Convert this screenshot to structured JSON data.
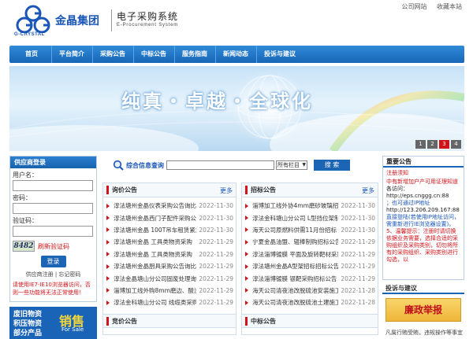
{
  "header": {
    "brand_cn": "金晶集团",
    "brand_logo_text": "G-CRYSTAL",
    "system_cn": "电子采购系统",
    "system_en": "E-Procurement System",
    "top_links": [
      "公司网站",
      "收藏本站"
    ]
  },
  "nav": {
    "items": [
      "首页",
      "平台简介",
      "采购公告",
      "中标公告",
      "服务指南",
      "新闻动态",
      "投诉与建议"
    ]
  },
  "banner": {
    "slogan": "纯真・卓越・全球化",
    "pages": [
      "1",
      "2",
      "3",
      "4"
    ],
    "active_page": "3"
  },
  "login": {
    "title": "供应商登录",
    "username_label": "用户名：",
    "password_label": "密码：",
    "captcha_label": "验证码：",
    "captcha_value": "8482",
    "refresh_link": "刷新验证码",
    "login_button": "登录",
    "register_link": "供应商注册",
    "forgot_link": "忘记密码",
    "warning": "请使用IE7-IE10浏览器访问，否则一些功能将无法正常使用！"
  },
  "promo": {
    "lines": [
      "废旧物资",
      "积压物资",
      "部分产品"
    ],
    "sale_cn": "销售",
    "sale_en": "For Sale"
  },
  "search": {
    "label": "综合信息查询",
    "select_value": "所有栏目",
    "button": "搜 索"
  },
  "inquiry": {
    "title": "询价公告",
    "more": "更多",
    "rows": [
      {
        "title": "淳法塘州金晶仪表采购公告询比价",
        "date": "2022-11-30"
      },
      {
        "title": "淳法塘州金晶西门子配件采购公告",
        "date": "2022-11-30"
      },
      {
        "title": "淳法塘州金晶 100T吊车租赁紧急",
        "date": "2022-11-30"
      },
      {
        "title": "淳法塘州金晶 工具类物资采购",
        "date": "2022-11-29"
      },
      {
        "title": "淳法塘州金晶 工具类物资采购",
        "date": "2022-11-29"
      },
      {
        "title": "淳法塘州金晶厨具采购公告询比价",
        "date": "2022-11-29"
      },
      {
        "title": "淳法金晶塘山分公司固废处理询比",
        "date": "2022-11-29"
      },
      {
        "title": "淄博加工线外购8mm磨边、酸洗玻",
        "date": "2022-11-29"
      },
      {
        "title": "淳法金科塘山分公司 线缆类采购询",
        "date": "2022-11-29"
      }
    ]
  },
  "tender": {
    "title": "招标公告",
    "more": "更多",
    "rows": [
      {
        "title": "淄博加工线外协4mm磨砂玻璃招标",
        "date": "2022-11-30"
      },
      {
        "title": "淳法金科塘山分公司 L型挡位架制",
        "date": "2022-11-30"
      },
      {
        "title": "海天公司原燃料供需11月份招标",
        "date": "2022-11-30"
      },
      {
        "title": "宁夏金晶油盟、辊棒制购招标公告",
        "date": "2022-11-29"
      },
      {
        "title": "淳法淄博镀膜 平面及旋转靶材采购",
        "date": "2022-11-29"
      },
      {
        "title": "淳法塘州金晶A型架招标招标公告",
        "date": "2022-11-29"
      },
      {
        "title": "淳法淄博镀膜 银靶采购招标公告",
        "date": "2022-11-29"
      },
      {
        "title": "海天公司清夜池改脱硫池安装施工",
        "date": "2022-11-28"
      },
      {
        "title": "海天公司清夜池改脱硫池土建施工",
        "date": "2022-11-28"
      }
    ]
  },
  "next_left_title": "竞价公告",
  "next_right_title": "中标公告",
  "notice": {
    "title": "重要公告",
    "subtitle": "注册须知",
    "lines": [
      {
        "text": "中有新增加户产可用证理知道",
        "cls": "red"
      },
      {
        "text": "各访问：",
        "cls": ""
      },
      {
        "text": "http://eps.cnggg.cn:88",
        "cls": ""
      },
      {
        "text": "；也可通过IP地址",
        "cls": "blue"
      },
      {
        "text": "http://123.206.209.167:88",
        "cls": ""
      },
      {
        "text": "直接登陆(若使用IP地址访问，需重新进行IE浏览器设置)。",
        "cls": "blue"
      },
      {
        "text": "5、温馨提示：注册时请切换依据业务需要，选择合适的采购组织及采购类别，切勿将所有的采购组织、采购类别进行勾选，以",
        "cls": "red"
      }
    ]
  },
  "suggest": {
    "title": "投诉与建议",
    "report": "廉政举报",
    "note": "凡属行贿受贿，违规操作等事宜"
  }
}
